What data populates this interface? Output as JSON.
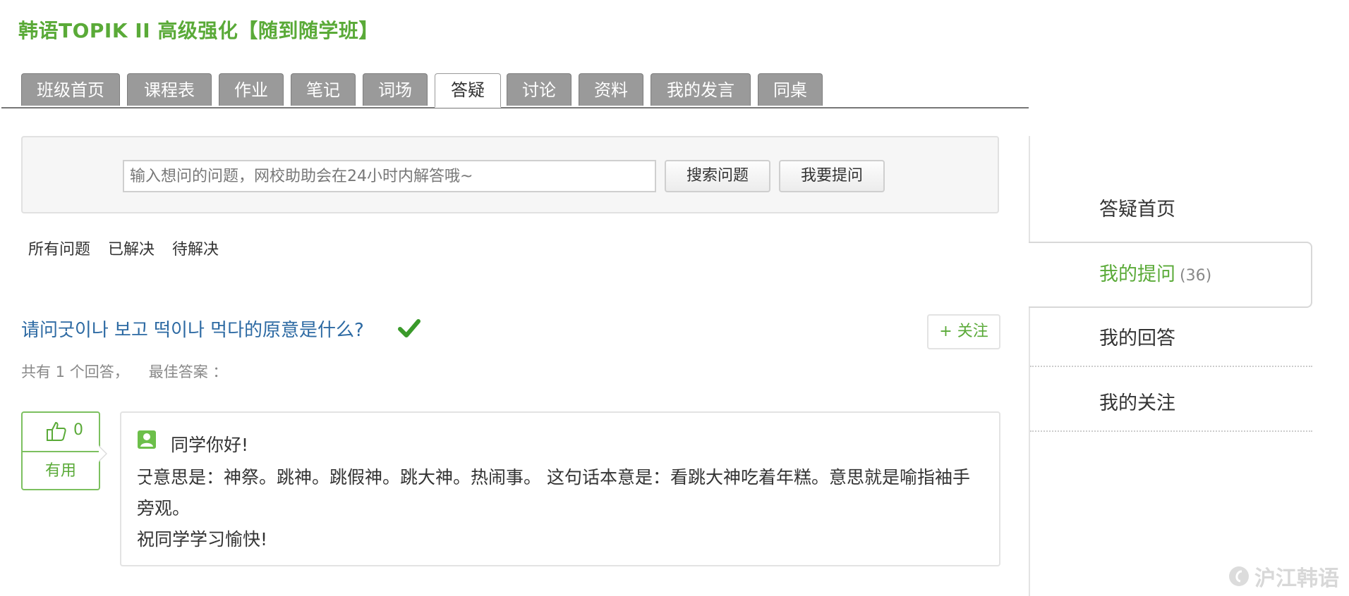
{
  "course": {
    "title": "韩语TOPIK II 高级强化【随到随学班】"
  },
  "tabs": [
    {
      "label": "班级首页"
    },
    {
      "label": "课程表"
    },
    {
      "label": "作业"
    },
    {
      "label": "笔记"
    },
    {
      "label": "词场"
    },
    {
      "label": "答疑",
      "active": true
    },
    {
      "label": "讨论"
    },
    {
      "label": "资料"
    },
    {
      "label": "我的发言"
    },
    {
      "label": "同桌"
    }
  ],
  "search": {
    "placeholder": "输入想问的问题，网校助助会在24小时内解答哦~",
    "search_label": "搜索问题",
    "ask_label": "我要提问"
  },
  "filters": {
    "all": "所有问题",
    "solved": "已解决",
    "pending": "待解决"
  },
  "question": {
    "title": "请问굿이나 보고 떡이나 먹다的原意是什么?",
    "follow_label": "+ 关注",
    "answer_count_text": "共有 1 个回答，",
    "best_answer_text": "最佳答案 ："
  },
  "answer": {
    "votes": "0",
    "useful_label": "有用",
    "greeting": "同学你好!",
    "line1": "굿意思是：神祭。跳神。跳假神。跳大神。热闹事。 这句话本意是：看跳大神吃着年糕。意思就是喻指袖手旁观。",
    "line2": "祝同学学习愉快!"
  },
  "sidebar": {
    "items": [
      {
        "label": "答疑首页"
      },
      {
        "label": "我的提问",
        "count": "(36)",
        "active": true
      },
      {
        "label": "我的回答"
      },
      {
        "label": "我的关注"
      }
    ]
  },
  "watermark": {
    "text": "沪江韩语"
  },
  "colors": {
    "accent": "#5aaa38",
    "link": "#2d6aa3",
    "tab_bg": "#9a9a9a"
  }
}
